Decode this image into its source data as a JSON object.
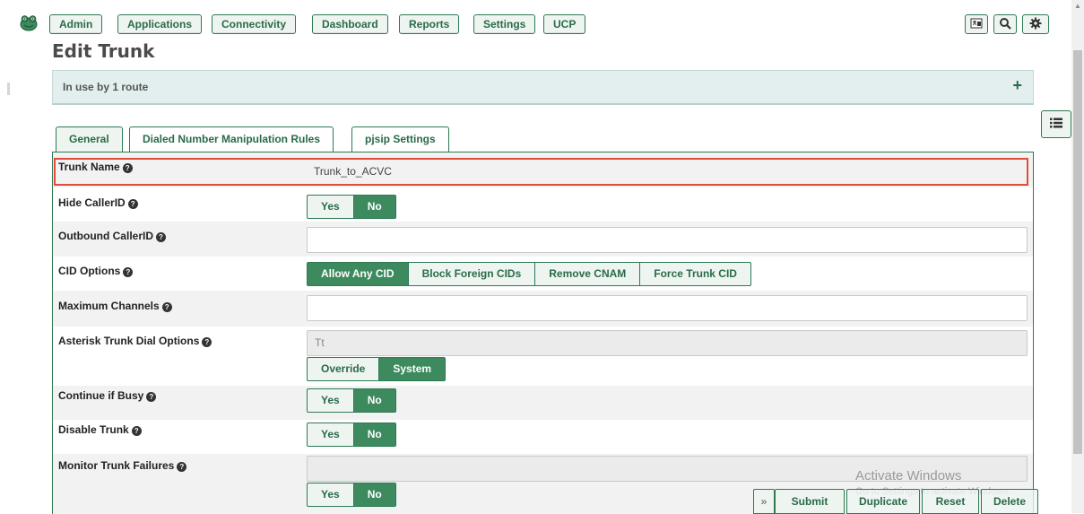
{
  "nav": {
    "items": [
      {
        "label": "Admin"
      },
      {
        "label": "Applications"
      },
      {
        "label": "Connectivity"
      },
      {
        "label": "Dashboard"
      },
      {
        "label": "Reports"
      },
      {
        "label": "Settings"
      },
      {
        "label": "UCP"
      }
    ],
    "right_icons": [
      "language-icon",
      "search-icon",
      "gear-icon"
    ]
  },
  "page": {
    "title": "Edit Trunk",
    "in_use": "In use by 1 route",
    "in_use_toggle": "+"
  },
  "tabs": [
    {
      "label": "General",
      "active": true
    },
    {
      "label": "Dialed Number Manipulation Rules",
      "active": false
    },
    {
      "label": "pjsip Settings",
      "active": false
    }
  ],
  "form": {
    "trunk_name": {
      "label": "Trunk Name",
      "value": "Trunk_to_ACVC"
    },
    "hide_callerid": {
      "label": "Hide CallerID",
      "options": [
        "Yes",
        "No"
      ],
      "selected": "No"
    },
    "outbound_callerid": {
      "label": "Outbound CallerID",
      "value": ""
    },
    "cid_options": {
      "label": "CID Options",
      "options": [
        "Allow Any CID",
        "Block Foreign CIDs",
        "Remove CNAM",
        "Force Trunk CID"
      ],
      "selected": "Allow Any CID"
    },
    "max_channels": {
      "label": "Maximum Channels",
      "value": ""
    },
    "dial_options": {
      "label": "Asterisk Trunk Dial Options",
      "value": "Tt",
      "options": [
        "Override",
        "System"
      ],
      "selected": "System"
    },
    "continue_if_busy": {
      "label": "Continue if Busy",
      "options": [
        "Yes",
        "No"
      ],
      "selected": "No"
    },
    "disable_trunk": {
      "label": "Disable Trunk",
      "options": [
        "Yes",
        "No"
      ],
      "selected": "No"
    },
    "monitor_failures": {
      "label": "Monitor Trunk Failures",
      "value": "",
      "options": [
        "Yes",
        "No"
      ],
      "selected": "No"
    }
  },
  "actions": {
    "collapse": "»",
    "submit": "Submit",
    "duplicate": "Duplicate",
    "reset": "Reset",
    "delete": "Delete"
  },
  "watermark": {
    "line1": "Activate Windows",
    "line2": "Go to Settings to activate Windows."
  },
  "colors": {
    "accent": "#2d7a52",
    "accent_active": "#3d8a5e",
    "highlight": "#e04b3c"
  }
}
